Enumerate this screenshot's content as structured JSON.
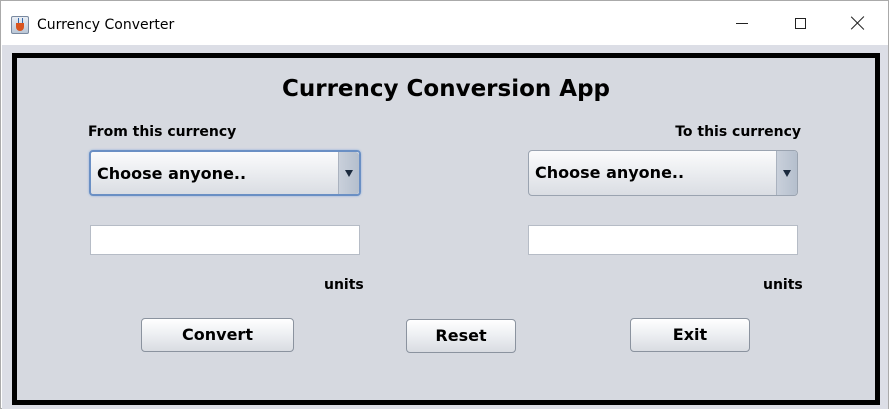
{
  "window": {
    "title": "Currency Converter",
    "app_icon": "java-cup-icon",
    "controls": {
      "minimize_icon": "minimize-icon",
      "maximize_icon": "maximize-icon",
      "close_icon": "close-icon"
    }
  },
  "main": {
    "heading": "Currency Conversion App",
    "from": {
      "label": "From this currency",
      "selected": "Choose anyone..",
      "amount_value": "",
      "units_label": "units"
    },
    "to": {
      "label": "To this currency",
      "selected": "Choose anyone..",
      "amount_value": "",
      "units_label": "units"
    },
    "buttons": {
      "convert": "Convert",
      "reset": "Reset",
      "exit": "Exit"
    }
  },
  "colors": {
    "panel_background": "#d6d9e0",
    "panel_border": "#000000",
    "focus_ring": "#6a8fc4"
  }
}
